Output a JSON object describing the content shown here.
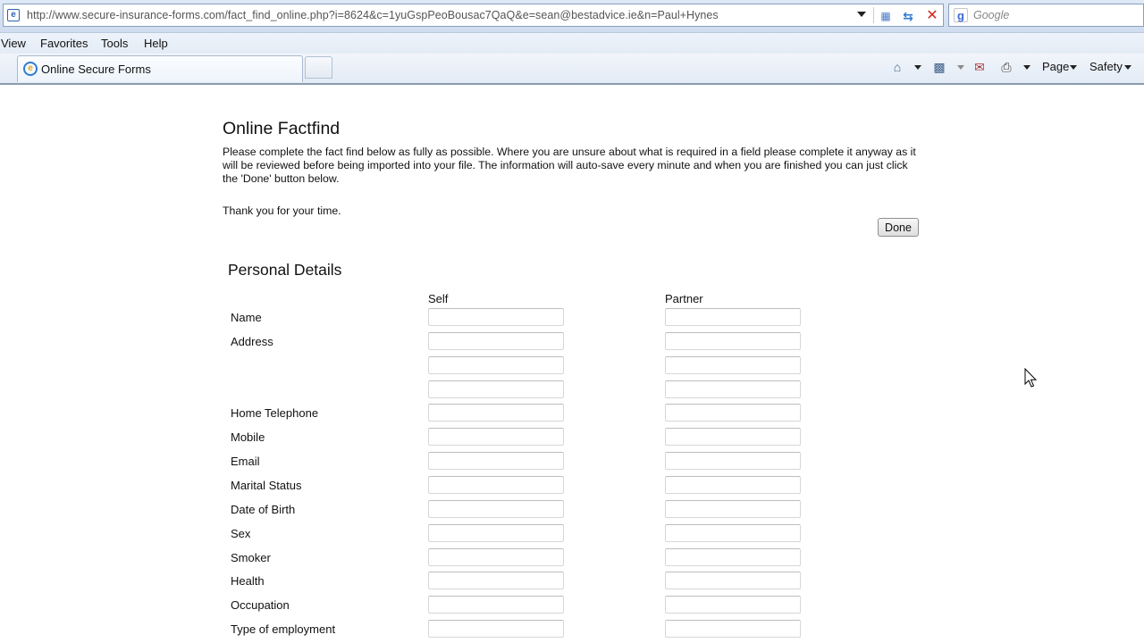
{
  "browser": {
    "url": "http://www.secure-insurance-forms.com/fact_find_online.php?i=8624&c=1yuGspPeoBousac7QaQ&e=sean@bestadvice.ie&n=Paul+Hynes",
    "search_placeholder": "Google",
    "menu": [
      "View",
      "Favorites",
      "Tools",
      "Help"
    ],
    "tab_title": "Online Secure Forms",
    "commands": {
      "page": "Page",
      "safety": "Safety"
    }
  },
  "page": {
    "title": "Online Factfind",
    "intro": "Please complete the fact find below as fully as possible. Where you are unsure about what is required in a field please complete it anyway as it will be reviewed before being imported into your file. The information will auto-save every minute and when you are finished you can just click the 'Done' button below.",
    "thanks": "Thank you for your time.",
    "done_label": "Done"
  },
  "personal_details": {
    "title": "Personal Details",
    "col_self": "Self",
    "col_partner": "Partner",
    "rows": [
      {
        "label": "Name",
        "self": "",
        "partner": ""
      },
      {
        "label": "Address",
        "self": "",
        "partner": ""
      },
      {
        "label": "",
        "self": "",
        "partner": ""
      },
      {
        "label": "",
        "self": "",
        "partner": ""
      },
      {
        "label": "Home Telephone",
        "self": "",
        "partner": ""
      },
      {
        "label": "Mobile",
        "self": "",
        "partner": ""
      },
      {
        "label": "Email",
        "self": "",
        "partner": ""
      },
      {
        "label": "Marital Status",
        "self": "",
        "partner": ""
      },
      {
        "label": "Date of Birth",
        "self": "",
        "partner": ""
      },
      {
        "label": "Sex",
        "self": "",
        "partner": ""
      },
      {
        "label": "Smoker",
        "self": "",
        "partner": ""
      },
      {
        "label": "Health",
        "self": "",
        "partner": ""
      },
      {
        "label": "Occupation",
        "self": "",
        "partner": ""
      },
      {
        "label": "Type of employment",
        "self": "",
        "partner": ""
      }
    ]
  }
}
